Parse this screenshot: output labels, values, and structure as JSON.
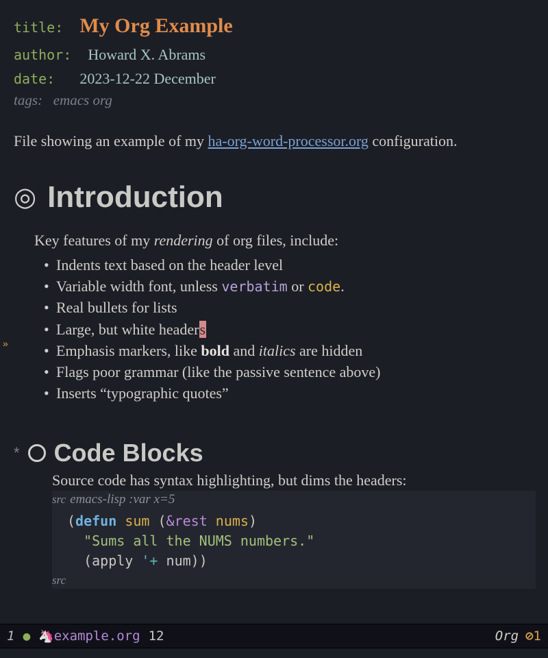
{
  "meta": {
    "title_key": "title",
    "title_val": "My Org Example",
    "author_key": "author",
    "author_val": "Howard X. Abrams",
    "date_key": "date",
    "date_val": "2023-12-22 December",
    "tags_key": "tags:",
    "tags_val": "emacs org"
  },
  "intro": {
    "pre": "File showing an example of my ",
    "link": "ha-org-word-processor.org",
    "post": " configuration."
  },
  "sections": {
    "s1": {
      "bullet": "◎",
      "title": "Introduction",
      "lead_pre": "Key features of my ",
      "lead_em": "rendering",
      "lead_post": " of org files, include:",
      "items": [
        "Indents text based on the header level",
        "Variable width font, unless ",
        "Real bullets for lists",
        "Large, but white header",
        "Emphasis markers, like ",
        "Flags poor grammar (like the passive sentence above)",
        "Inserts “typographic quotes”"
      ],
      "item1_verbatim": "verbatim",
      "item1_or": " or ",
      "item1_code": "code",
      "item1_dot": ".",
      "item3_cursor": "s",
      "item4_bold": "bold",
      "item4_and": " and ",
      "item4_italics": "italics",
      "item4_post": " are hidden"
    },
    "s2": {
      "star": "*",
      "title": "Code Blocks",
      "lead": "Source code has syntax highlighting, but dims the headers:",
      "src_label": "src",
      "src_header": "emacs-lisp :var x=5",
      "code": {
        "l1_open": "(",
        "l1_kw": "defun",
        "l1_sp1": " ",
        "l1_fn": "sum",
        "l1_sp2": " (",
        "l1_amp": "&rest",
        "l1_sp3": " ",
        "l1_arg": "nums",
        "l1_close": ")",
        "l2": "  \"Sums all the NUMS numbers.\"",
        "l3_pre": "  (",
        "l3_apply": "apply",
        "l3_sp": " ",
        "l3_quote": "'+",
        "l3_sp2": " ",
        "l3_num": "num",
        "l3_close": "))"
      },
      "src_end": "src"
    }
  },
  "fringe": {
    "arrow": "»"
  },
  "modeline": {
    "win_num": "1",
    "dot": "●",
    "unicorn": "🦄",
    "filename": "example.org",
    "col": "12",
    "major_mode": "Org",
    "warn_icon": "⊘",
    "warn_count": "1"
  }
}
